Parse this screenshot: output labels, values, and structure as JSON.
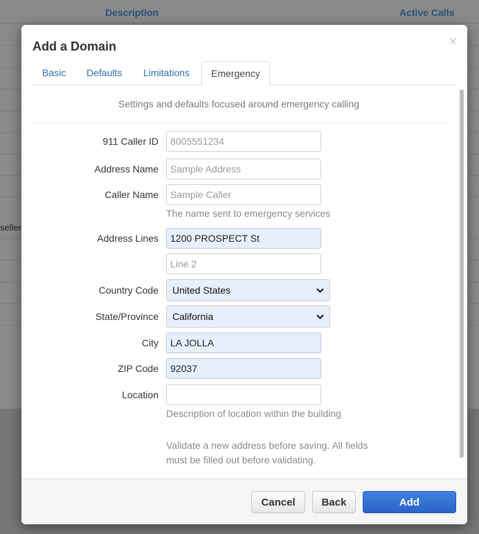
{
  "background": {
    "col_description": "Description",
    "col_active_calls": "Active Calls",
    "side_text": "seller"
  },
  "modal": {
    "title": "Add a Domain",
    "close_glyph": "×",
    "tabs": [
      {
        "label": "Basic"
      },
      {
        "label": "Defaults"
      },
      {
        "label": "Limitations"
      },
      {
        "label": "Emergency",
        "active": true
      }
    ],
    "intro": "Settings and defaults focused around emergency calling",
    "fields": {
      "caller_id": {
        "label": "911 Caller ID",
        "placeholder": "8005551234",
        "value": ""
      },
      "address_name": {
        "label": "Address Name",
        "placeholder": "Sample Address",
        "value": ""
      },
      "caller_name": {
        "label": "Caller Name",
        "placeholder": "Sample Caller",
        "value": "",
        "help": "The name sent to emergency services"
      },
      "address_lines": {
        "label": "Address Lines",
        "line1": "1200 PROSPECT St",
        "line2_placeholder": "Line 2"
      },
      "country_code": {
        "label": "Country Code",
        "selected": "United States"
      },
      "state_province": {
        "label": "State/Province",
        "selected": "California"
      },
      "city": {
        "label": "City",
        "value": "LA JOLLA"
      },
      "zip_code": {
        "label": "ZIP Code",
        "value": "92037"
      },
      "location": {
        "label": "Location",
        "value": "",
        "help": "Description of location within the building"
      }
    },
    "validate_note_line1": "Validate a new address before saving. All fields",
    "validate_note_line2": "must be filled out before validating.",
    "buttons": {
      "cancel": "Cancel",
      "back": "Back",
      "add": "Add"
    }
  },
  "colors": {
    "primary": "#2a62c9",
    "link": "#2f6db0",
    "autofill": "#e8effc"
  },
  "icons": {
    "select_arrow": "chevron-down-icon",
    "close": "close-icon"
  }
}
